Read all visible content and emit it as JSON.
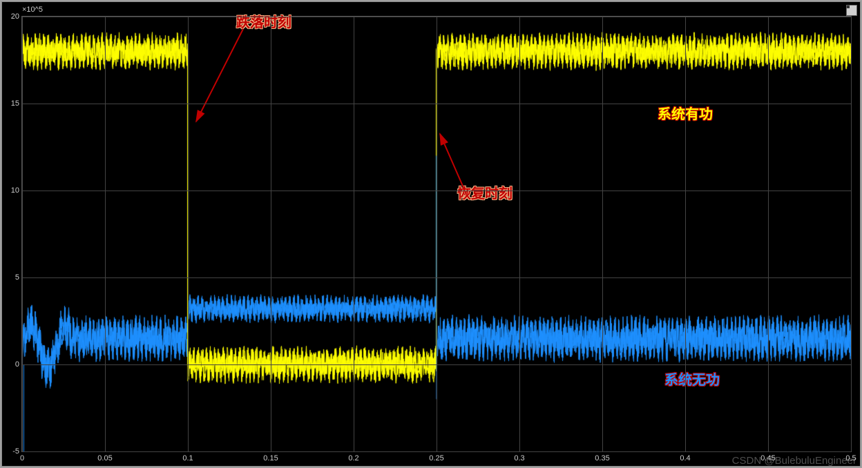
{
  "chart_data": {
    "type": "line",
    "title": "",
    "xlabel": "",
    "ylabel": "",
    "y_exponent_label": "×10^5",
    "xlim": [
      0,
      0.5
    ],
    "ylim": [
      -5,
      20
    ],
    "x_ticks": [
      0,
      0.05,
      0.1,
      0.15,
      0.2,
      0.25,
      0.3,
      0.35,
      0.4,
      0.45,
      0.5
    ],
    "y_ticks": [
      -5,
      0,
      5,
      10,
      15,
      20
    ],
    "series": [
      {
        "name": "系统有功",
        "color": "#ffff00",
        "segments": [
          {
            "t_start": 0.0,
            "t_end": 0.1,
            "mean": 18.0,
            "noise_amp": 0.8
          },
          {
            "t_start": 0.1,
            "t_end": 0.25,
            "mean": 0.0,
            "noise_amp": 0.8
          },
          {
            "t_start": 0.25,
            "t_end": 0.5,
            "mean": 18.0,
            "noise_amp": 0.8
          }
        ]
      },
      {
        "name": "系统无功",
        "color": "#1e90ff",
        "segments": [
          {
            "t_start": 0.0,
            "t_end": 0.1,
            "mean": 1.5,
            "noise_amp": 1.0
          },
          {
            "t_start": 0.1,
            "t_end": 0.25,
            "mean": 3.2,
            "noise_amp": 0.6
          },
          {
            "t_start": 0.25,
            "t_end": 0.5,
            "mean": 1.5,
            "noise_amp": 1.0
          }
        ]
      }
    ],
    "events": {
      "dip_time": 0.1,
      "restore_time": 0.25
    },
    "annotations": {
      "dip_label": "跌落时刻",
      "restore_label": "恢复时刻",
      "active_power_label": "系统有功",
      "reactive_power_label": "系统无功"
    }
  },
  "watermark": "CSDN @BulebuluEngineer"
}
